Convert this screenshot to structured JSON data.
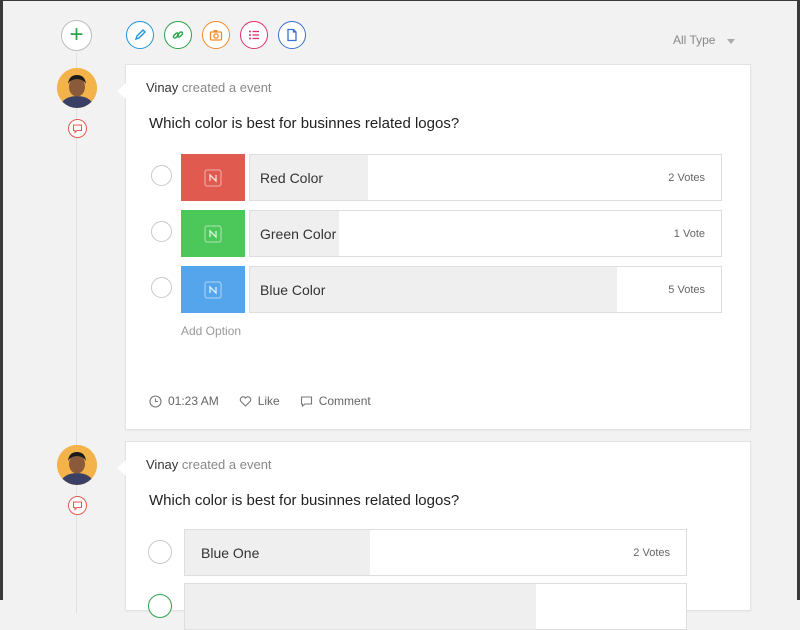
{
  "toolbar": {
    "add_symbol": "+",
    "tools": [
      {
        "name": "pencil-icon",
        "color": "#2196d9"
      },
      {
        "name": "link-icon",
        "color": "#2aa34a"
      },
      {
        "name": "camera-icon",
        "color": "#f08c2a"
      },
      {
        "name": "list-icon",
        "color": "#e0306a"
      },
      {
        "name": "document-icon",
        "color": "#3b6fd4"
      }
    ],
    "type_filter": "All Type"
  },
  "posts": [
    {
      "user": "Vinay",
      "action": "created a event",
      "question": "Which color is best for businnes related logos?",
      "options": [
        {
          "label": "Red Color",
          "votes": "2 Votes",
          "swatch": "#e05a4f",
          "share": 0.25
        },
        {
          "label": "Green Color",
          "votes": "1 Vote",
          "swatch": "#4cc85a",
          "share": 0.19
        },
        {
          "label": "Blue Color",
          "votes": "5 Votes",
          "swatch": "#55a5ec",
          "share": 0.78
        }
      ],
      "add_option": "Add Option",
      "time": "01:23 AM",
      "like": "Like",
      "comment": "Comment"
    },
    {
      "user": "Vinay",
      "action": "created a event",
      "question": "Which color is best for businnes related logos?",
      "options": [
        {
          "label": "Blue One",
          "votes": "2 Votes",
          "share": 0.37
        }
      ]
    }
  ]
}
